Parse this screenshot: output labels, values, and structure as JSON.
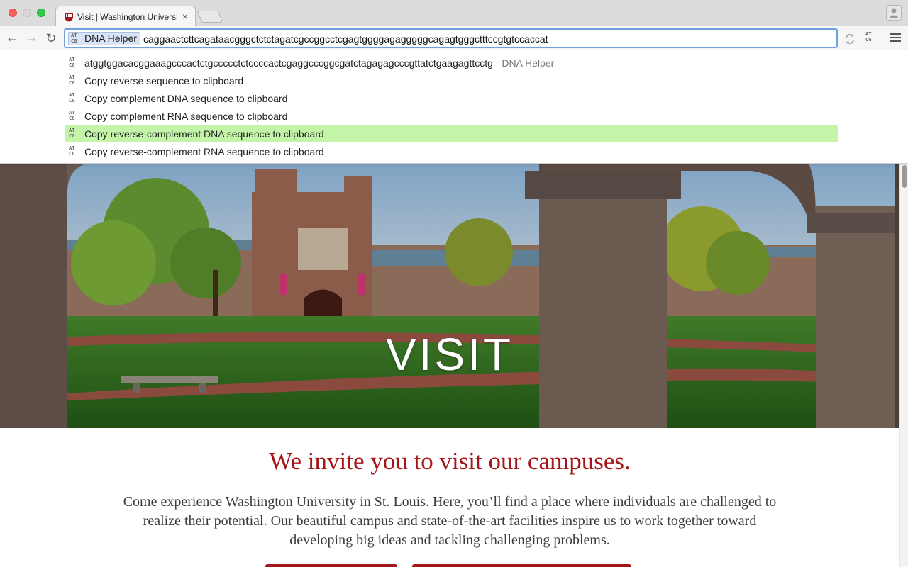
{
  "browser": {
    "tab": {
      "title": "Visit | Washington Universi",
      "close_symbol": "×"
    },
    "nav": {
      "back": "←",
      "forward": "→",
      "reload": "↻"
    },
    "omnibox": {
      "keyword_label": "DNA Helper",
      "value": "caggaactcttcagataacgggctctctagatcgccggcctcgagtggggagagggggcagagtgggctttccgtgtccaccat"
    },
    "atcg_icon": {
      "row1": "AT",
      "row2": "CG"
    }
  },
  "suggestions": [
    {
      "text": "atggtggacacggaaagcccactctgccccctctccccactcgaggcccggcgatctagagagcccgttatctgaagagttcctg",
      "description": " - DNA Helper",
      "selected": false
    },
    {
      "text": "Copy reverse sequence to clipboard",
      "description": "",
      "selected": false
    },
    {
      "text": "Copy complement DNA sequence to clipboard",
      "description": "",
      "selected": false
    },
    {
      "text": "Copy complement RNA sequence to clipboard",
      "description": "",
      "selected": false
    },
    {
      "text": "Copy reverse-complement DNA sequence to clipboard",
      "description": "",
      "selected": true
    },
    {
      "text": "Copy reverse-complement RNA sequence to clipboard",
      "description": "",
      "selected": false
    }
  ],
  "page": {
    "hero_title": "VISIT",
    "heading": "We invite you to visit our campuses.",
    "body": "Come experience Washington University in St. Louis. Here, you’ll find a place where individuals are challenged to realize their potential. Our beautiful campus and state-of-the-art facilities inspire us to work together toward developing big ideas and tackling challenging problems."
  },
  "colors": {
    "brand_red": "#a51417",
    "selection_green": "#c4f4a8",
    "focus_blue": "#6f9fde"
  }
}
